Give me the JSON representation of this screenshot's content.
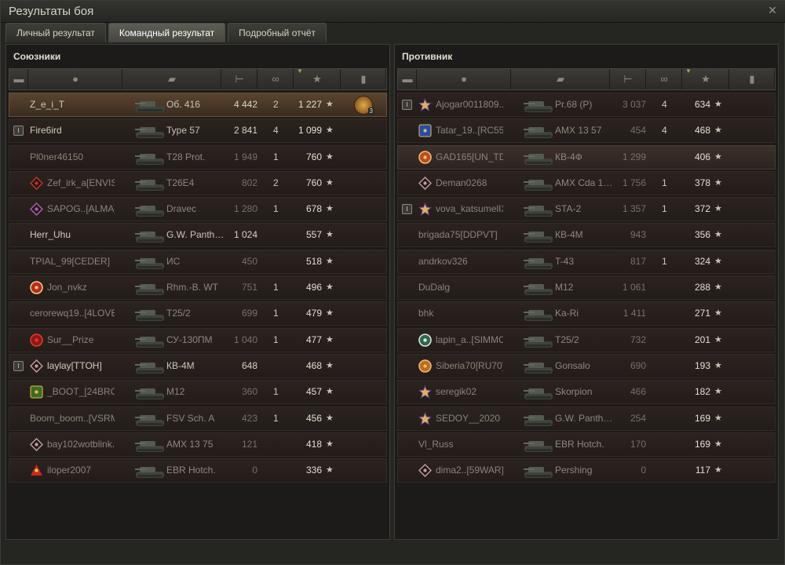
{
  "window": {
    "title": "Результаты боя",
    "close_glyph": "×"
  },
  "tabs": [
    {
      "label": "Личный результат",
      "active": false
    },
    {
      "label": "Командный результат",
      "active": true
    },
    {
      "label": "Подробный отчёт",
      "active": false
    }
  ],
  "columns": {
    "icons": [
      "platoon-icon",
      "player-icon",
      "tank-icon",
      "damage-icon",
      "frags-icon",
      "experience-star-icon",
      "medal-icon"
    ],
    "sorted_by": "experience"
  },
  "allies": {
    "title": "Союзники",
    "rows": [
      {
        "name": "Z_e_i_T",
        "tank": "Об. 416",
        "damage": "4 442",
        "frags": "2",
        "xp": "1 227",
        "alive": true,
        "me": true,
        "platoon": false,
        "clan_icon": "",
        "medal": "3"
      },
      {
        "name": "Fire6ird",
        "tank": "Type 57",
        "damage": "2 841",
        "frags": "4",
        "xp": "1 099",
        "alive": true,
        "platoon": true,
        "clan_icon": ""
      },
      {
        "name": "Pl0ner46150",
        "tank": "T28 Prot.",
        "damage": "1 949",
        "frags": "1",
        "xp": "760",
        "alive": false,
        "clan_icon": ""
      },
      {
        "name": "Zef_irk_a[ENVIS]",
        "tank": "T26E4",
        "damage": "802",
        "frags": "2",
        "xp": "760",
        "alive": false,
        "clan_icon": "diamond-red"
      },
      {
        "name": "SAPOG..[ALMA]",
        "tank": "Dravec",
        "damage": "1 280",
        "frags": "1",
        "xp": "678",
        "alive": false,
        "clan_icon": "diamond-purple"
      },
      {
        "name": "Herr_Uhu",
        "tank": "G.W. Panth…",
        "damage": "1 024",
        "frags": "",
        "xp": "557",
        "alive": true,
        "clan_icon": ""
      },
      {
        "name": "TPIAL_99[CEDER]",
        "tank": "ИС",
        "damage": "450",
        "frags": "",
        "xp": "518",
        "alive": false,
        "clan_icon": ""
      },
      {
        "name": "Jon_nvkz",
        "tank": "Rhm.-B. WT",
        "damage": "751",
        "frags": "1",
        "xp": "496",
        "alive": false,
        "clan_icon": "red-badge"
      },
      {
        "name": "cerorewq19..[4LOVE]",
        "tank": "T25/2",
        "damage": "699",
        "frags": "1",
        "xp": "479",
        "alive": false,
        "clan_icon": ""
      },
      {
        "name": "Sur__Prize",
        "tank": "СУ-130ПМ",
        "damage": "1 040",
        "frags": "1",
        "xp": "477",
        "alive": false,
        "clan_icon": "red-helmet"
      },
      {
        "name": "laylay[TTOH]",
        "tank": "КВ-4М",
        "damage": "648",
        "frags": "",
        "xp": "468",
        "alive": true,
        "platoon": true,
        "clan_icon": "diamond-dark"
      },
      {
        "name": "_BOOT_[24BRO]",
        "tank": "M12",
        "damage": "360",
        "frags": "1",
        "xp": "457",
        "alive": false,
        "clan_icon": "green-house"
      },
      {
        "name": "Boom_boom..[VSRM]",
        "tank": "FSV Sch. A",
        "damage": "423",
        "frags": "1",
        "xp": "456",
        "alive": false,
        "clan_icon": ""
      },
      {
        "name": "bay102wotblink..",
        "tank": "AMX 13 75",
        "damage": "121",
        "frags": "",
        "xp": "418",
        "alive": false,
        "clan_icon": "diamond-dark"
      },
      {
        "name": "iloper2007",
        "tank": "EBR Hotch.",
        "damage": "0",
        "frags": "",
        "xp": "336",
        "alive": false,
        "clan_icon": "red-triangle"
      }
    ]
  },
  "enemies": {
    "title": "Противник",
    "rows": [
      {
        "name": "Ajogar0011809..",
        "tank": "Pr.68 (P)",
        "damage": "3 037",
        "frags": "4",
        "xp": "634",
        "alive": false,
        "platoon": true,
        "clan_icon": "purple-star"
      },
      {
        "name": "Tatar_19..[RC55]",
        "tank": "AMX 13 57",
        "damage": "454",
        "frags": "4",
        "xp": "468",
        "alive": false,
        "clan_icon": "blue-stripe"
      },
      {
        "name": "GAD165[UN_TD]",
        "tank": "КВ-4Ф",
        "damage": "1 299",
        "frags": "",
        "xp": "406",
        "alive": false,
        "highlight": true,
        "clan_icon": "orange-shield"
      },
      {
        "name": "Deman0268",
        "tank": "AMX Cda 1…",
        "damage": "1 756",
        "frags": "1",
        "xp": "378",
        "alive": false,
        "clan_icon": "diamond-dark"
      },
      {
        "name": "vova_katsumelIX",
        "tank": "STA-2",
        "damage": "1 357",
        "frags": "1",
        "xp": "372",
        "alive": false,
        "platoon": true,
        "clan_icon": "purple-star"
      },
      {
        "name": "brigada75[DDPVT]",
        "tank": "КВ-4М",
        "damage": "943",
        "frags": "",
        "xp": "356",
        "alive": false,
        "clan_icon": ""
      },
      {
        "name": "andrkov326",
        "tank": "T-43",
        "damage": "817",
        "frags": "1",
        "xp": "324",
        "alive": false,
        "clan_icon": ""
      },
      {
        "name": "DuDalg",
        "tank": "M12",
        "damage": "1 061",
        "frags": "",
        "xp": "288",
        "alive": false,
        "clan_icon": ""
      },
      {
        "name": "bhk",
        "tank": "Ka-Ri",
        "damage": "1 411",
        "frags": "",
        "xp": "271",
        "alive": false,
        "clan_icon": ""
      },
      {
        "name": "lapin_a..[SIMMC]",
        "tank": "T25/2",
        "damage": "732",
        "frags": "",
        "xp": "201",
        "alive": false,
        "clan_icon": "green-circle"
      },
      {
        "name": "Siberia70[RU70]",
        "tank": "Gonsalo",
        "damage": "690",
        "frags": "",
        "xp": "193",
        "alive": false,
        "clan_icon": "orange-fox"
      },
      {
        "name": "seregik02",
        "tank": "Skorpion",
        "damage": "466",
        "frags": "",
        "xp": "182",
        "alive": false,
        "clan_icon": "purple-star"
      },
      {
        "name": "SEDOY__2020",
        "tank": "G.W. Panth…",
        "damage": "254",
        "frags": "",
        "xp": "169",
        "alive": false,
        "clan_icon": "purple-star"
      },
      {
        "name": "Vl_Russ",
        "tank": "EBR Hotch.",
        "damage": "170",
        "frags": "",
        "xp": "169",
        "alive": false,
        "clan_icon": ""
      },
      {
        "name": "dima2..[59WAR]",
        "tank": "Pershing",
        "damage": "0",
        "frags": "",
        "xp": "117",
        "alive": false,
        "clan_icon": "diamond-dark"
      }
    ]
  }
}
